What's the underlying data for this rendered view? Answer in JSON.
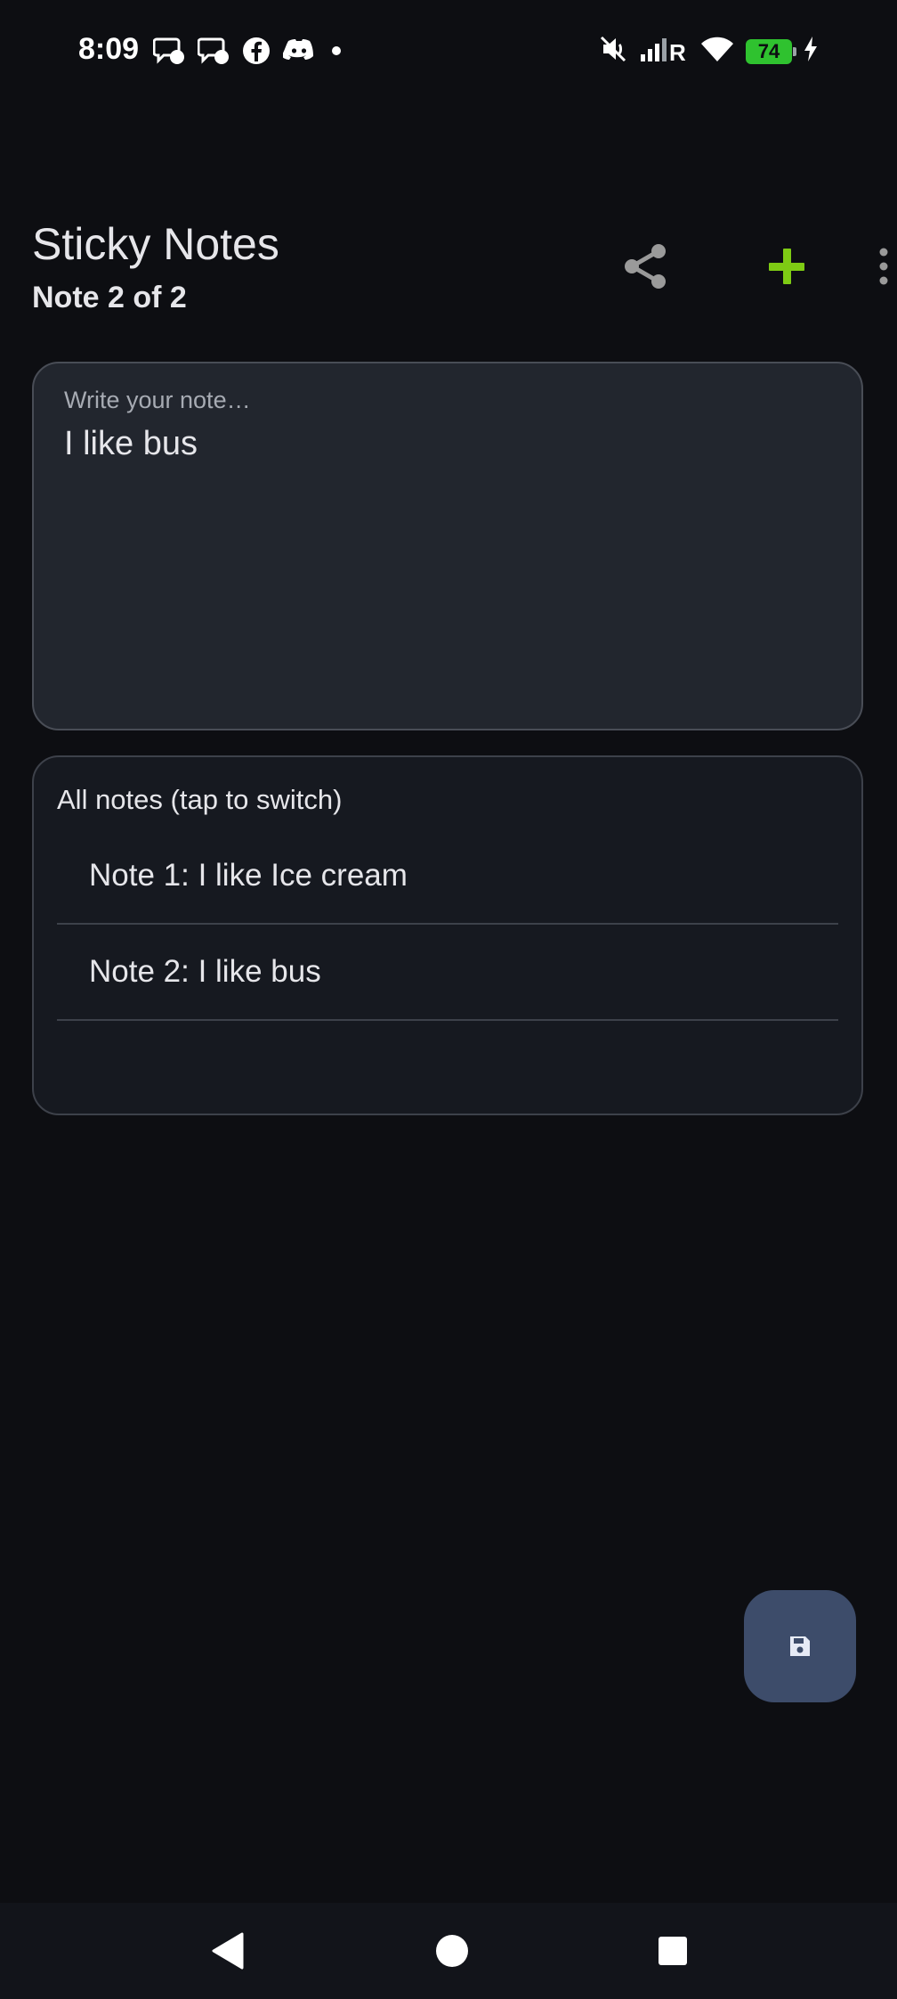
{
  "status_bar": {
    "time": "8:09",
    "battery": "74",
    "notification_icons": [
      "messenger-icon",
      "messenger-icon",
      "facebook-icon",
      "discord-icon",
      "dot-icon"
    ],
    "system_icons": [
      "mute-icon",
      "signal-icon",
      "wifi-icon",
      "battery-icon",
      "charging-icon"
    ]
  },
  "app_bar": {
    "title": "Sticky Notes",
    "subtitle": "Note 2 of 2",
    "actions": [
      "share-icon",
      "plus-icon",
      "more-vert-icon"
    ]
  },
  "editor": {
    "placeholder": "Write your note…",
    "value": "I like bus"
  },
  "notes_list": {
    "header": "All notes (tap to switch)",
    "items": [
      {
        "label": "Note 1: I like Ice cream"
      },
      {
        "label": "Note 2: I like bus"
      }
    ]
  },
  "fab": {
    "icon": "save-icon"
  },
  "colors": {
    "background": "#0d0e12",
    "accent_add": "#7ecb14",
    "fab": "#3d4c6a",
    "battery": "#2fc22f"
  }
}
